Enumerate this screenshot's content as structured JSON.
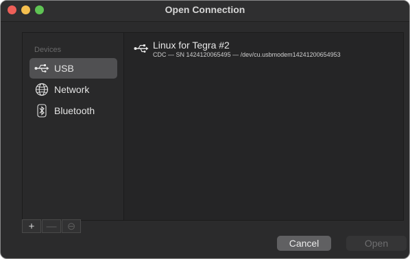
{
  "window": {
    "title": "Open Connection"
  },
  "sidebar": {
    "section_header": "Devices",
    "items": [
      {
        "label": "USB",
        "icon": "usb-icon",
        "selected": true
      },
      {
        "label": "Network",
        "icon": "globe-icon",
        "selected": false
      },
      {
        "label": "Bluetooth",
        "icon": "bluetooth-icon",
        "selected": false
      }
    ]
  },
  "device": {
    "name": "Linux for Tegra #2",
    "detail": "CDC — SN 1424120065495 — /dev/cu.usbmodem14241200654953",
    "icon": "usb-icon"
  },
  "toolbar": {
    "add_label": "+",
    "remove_label": "—",
    "more_label": "⊖"
  },
  "buttons": {
    "cancel_label": "Cancel",
    "open_label": "Open"
  },
  "colors": {
    "window_bg": "#2b2b2c",
    "selected_bg": "#505052",
    "close": "#ee5f58",
    "minimize": "#f5bf4f",
    "zoom": "#5fc454"
  }
}
